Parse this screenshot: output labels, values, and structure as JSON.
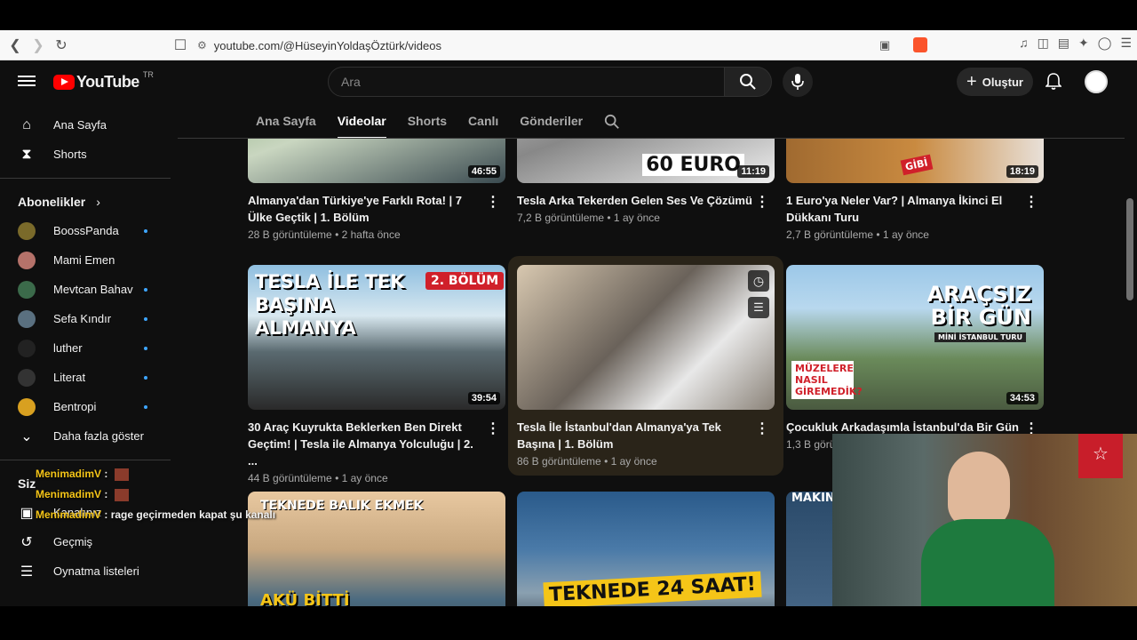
{
  "browser": {
    "url": "youtube.com/@HüseyinYoldaşÖztürk/videos"
  },
  "masthead": {
    "logo_text": "YouTube",
    "region": "TR",
    "search_placeholder": "Ara",
    "create_label": "Oluştur"
  },
  "sidebar": {
    "main": [
      {
        "label": "Ana Sayfa",
        "icon": "home-icon"
      },
      {
        "label": "Shorts",
        "icon": "shorts-icon"
      }
    ],
    "subscriptions_heading": "Abonelikler",
    "subscriptions": [
      {
        "label": "BoossPanda",
        "color": "#7a6a2a",
        "dot": true
      },
      {
        "label": "Mami Emen",
        "color": "#b5726a",
        "dot": false
      },
      {
        "label": "Mevtcan Bahav",
        "color": "#3b6a4a",
        "dot": true
      },
      {
        "label": "Sefa Kındır",
        "color": "#5a7080",
        "dot": true
      },
      {
        "label": "luther",
        "color": "#222222",
        "dot": true
      },
      {
        "label": "Literat",
        "color": "#333333",
        "dot": true
      },
      {
        "label": "Bentropi",
        "color": "#d8a020",
        "dot": true
      }
    ],
    "show_more": "Daha fazla göster",
    "you_heading": "Siz",
    "you_items": [
      {
        "label": "Kanalınız",
        "icon": "channel-icon"
      },
      {
        "label": "Geçmiş",
        "icon": "history-icon"
      },
      {
        "label": "Oynatma listeleri",
        "icon": "playlist-icon"
      }
    ]
  },
  "tabs": [
    "Ana Sayfa",
    "Videolar",
    "Shorts",
    "Canlı",
    "Gönderiler"
  ],
  "active_tab": "Videolar",
  "videos": [
    {
      "title": "Almanya'dan Türkiye'ye Farklı Rota! | 7 Ülke Geçtik | 1. Bölüm",
      "meta": "28 B görüntüleme • 2 hafta önce",
      "duration": "46:55",
      "overlay": ""
    },
    {
      "title": "Tesla Arka Tekerden Gelen Ses Ve Çözümü",
      "meta": "7,2 B görüntüleme • 1 ay önce",
      "duration": "11:19",
      "overlay": "60 EURO"
    },
    {
      "title": "1 Euro'ya Neler Var? | Almanya İkinci El Dükkanı Turu",
      "meta": "2,7 B görüntüleme • 1 ay önce",
      "duration": "18:19",
      "overlay": "GİBİ"
    },
    {
      "title": "30 Araç Kuyrukta Beklerken Ben Direkt Geçtim! | Tesla ile Almanya Yolculuğu | 2. ...",
      "meta": "44 B görüntüleme • 1 ay önce",
      "duration": "39:54",
      "overlay": "TESLA İLE TEK BAŞINA ALMANYA",
      "badge": "2. BÖLÜM"
    },
    {
      "title": "Tesla İle İstanbul'dan Almanya'ya Tek Başına | 1. Bölüm",
      "meta": "86 B görüntüleme • 1 ay önce",
      "duration": "",
      "overlay": ""
    },
    {
      "title": "Çocukluk Arkadaşımla İstanbul'da Bir Gün",
      "meta": "1,3 B görü",
      "duration": "34:53",
      "overlay": "ARAÇSIZ BİR GÜN",
      "sub_overlay": "MİNİ İSTANBUL TURU",
      "tag": "MÜZELERE NASIL GİREMEDİK?"
    },
    {
      "title": "",
      "meta": "",
      "duration": "",
      "overlay": "TEKNEDE BALIK EKMEK",
      "sub_overlay": "AKÜ BİTTİ"
    },
    {
      "title": "",
      "meta": "",
      "duration": "",
      "overlay": "TEKNEDE 24 SAAT!"
    },
    {
      "title": "",
      "meta": "",
      "duration": "",
      "overlay": "MAKIN"
    }
  ],
  "chat": [
    {
      "user": "MenimadimV",
      "message": ""
    },
    {
      "user": "MenimadimV",
      "message": ""
    },
    {
      "user": "MenimadimV",
      "message": "rage geçirmeden kapat şu kanalı"
    }
  ]
}
